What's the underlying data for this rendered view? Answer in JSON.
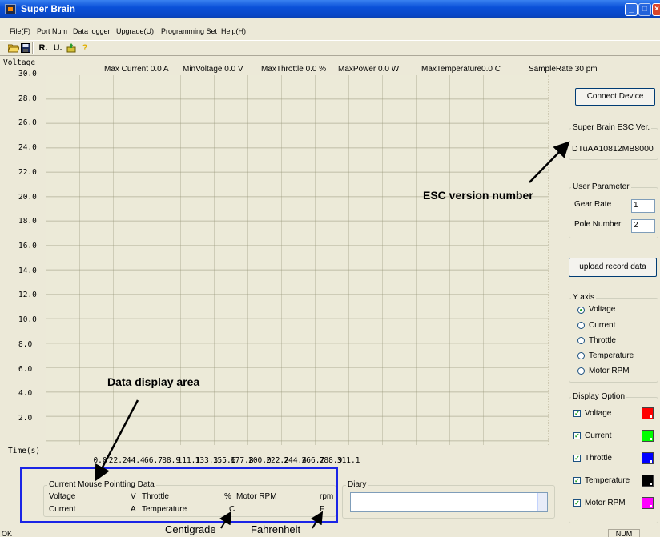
{
  "window": {
    "title": "Super Brain"
  },
  "menu": [
    "File(F)",
    "Port Num",
    "Data logger",
    "Upgrade(U)",
    "Programming Set",
    "Help(H)"
  ],
  "toolbar_icons": [
    "open-folder-icon",
    "save-icon",
    "r-icon",
    "u-icon",
    "upload-icon",
    "help-icon"
  ],
  "toolbar_glyphs": {
    "r": "R.",
    "u": "U.",
    "help": "?"
  },
  "stats": {
    "max_current": "Max Current 0.0   A",
    "min_voltage": "MinVoltage   0.0   V",
    "max_throttle": "MaxThrottle  0.0    %",
    "max_power": "MaxPower  0.0    W",
    "max_temperature": "MaxTemperature0.0    C",
    "sample_rate": "SampleRate  30   pm"
  },
  "chart_data": {
    "type": "line",
    "ylabel": "Voltage",
    "xlabel": "Time(s)",
    "ylim": [
      0,
      30
    ],
    "yticks": [
      "30.0",
      "28.0",
      "26.0",
      "24.0",
      "22.0",
      "20.0",
      "18.0",
      "16.0",
      "14.0",
      "12.0",
      "10.0",
      "8.0",
      "6.0",
      "4.0",
      "2.0"
    ],
    "xticks": [
      "0.0",
      "22.2",
      "44.4",
      "66.7",
      "88.9",
      "111.1",
      "133.3",
      "155.6",
      "177.8",
      "200.0",
      "222.2",
      "244.4",
      "266.7",
      "288.9",
      "311.1"
    ],
    "series": [],
    "grid": true
  },
  "right_panel": {
    "connect_label": "Connect Device",
    "esc_group_title": "Super Brain ESC Ver.",
    "esc_version": "DTuAA10812MB8000",
    "user_param_title": "User Parameter",
    "gear_rate_label": "Gear Rate",
    "gear_rate_value": "1",
    "pole_number_label": "Pole Number",
    "pole_number_value": "2",
    "upload_label": "upload record data",
    "y_axis_title": "Y axis",
    "y_axis_options": [
      "Voltage",
      "Current",
      "Throttle",
      "Temperature",
      "Motor RPM"
    ],
    "y_axis_selected": "Voltage",
    "display_option_title": "Display Option",
    "display_options": [
      {
        "label": "Voltage",
        "color": "#ff0000",
        "checked": true
      },
      {
        "label": "Current",
        "color": "#00ff00",
        "checked": true
      },
      {
        "label": "Throttle",
        "color": "#0000ff",
        "checked": true
      },
      {
        "label": "Temperature",
        "color": "#000000",
        "checked": true
      },
      {
        "label": "Motor RPM",
        "color": "#ff00ff",
        "checked": true
      }
    ]
  },
  "mouse_data": {
    "title": "Current Mouse Pointting Data",
    "voltage": "Voltage",
    "v_unit": "V",
    "throttle": "Throttle",
    "pct_unit": "%",
    "motor_rpm": "Motor RPM",
    "rpm_unit": "rpm",
    "current": "Current",
    "a_unit": "A",
    "temperature": "Temperature",
    "c_unit": "C",
    "f_unit": "F"
  },
  "diary": {
    "title": "Diary"
  },
  "annotations": {
    "esc_version": "ESC version number",
    "data_display": "Data display area",
    "centigrade": "Centigrade",
    "fahrenheit": "Fahrenheit"
  },
  "status": {
    "left": "OK",
    "right": "NUM"
  },
  "colors": {
    "annotation_box": "#1a24e6",
    "titlebar": "#0a50d8"
  }
}
